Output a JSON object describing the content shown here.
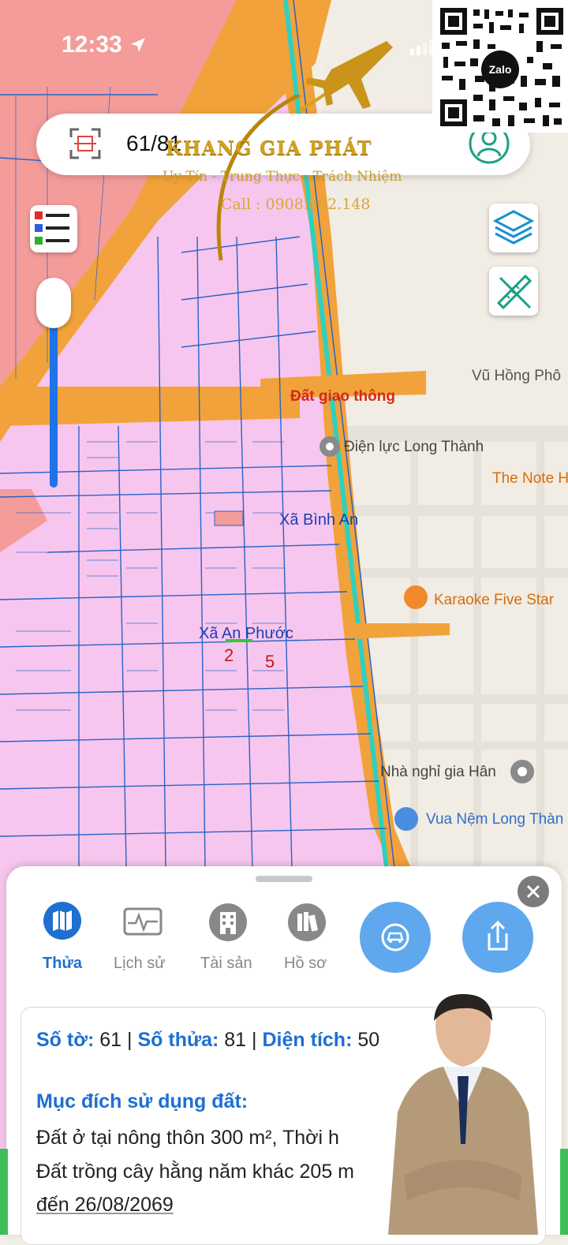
{
  "status": {
    "time": "12:33"
  },
  "search": {
    "value": "61/81"
  },
  "watermark": {
    "brand": "KHANG GIA PHÁT",
    "slogan": "Uy Tín - Trung Thực - Trách Nhiệm",
    "call": "Call : 0908.862.148",
    "qr_badge": "Zalo"
  },
  "map": {
    "labels": {
      "road_vu_hong_pho": "Vũ Hồng Phô",
      "dat_giao_thong": "Đất giao thông",
      "dien_luc": "Điện lực Long Thành",
      "the_note": "The Note H",
      "xa_binh_an": "Xã Bình An",
      "karaoke": "Karaoke Five Star",
      "xa_an_phuoc": "Xã An Phước",
      "nha_nghi": "Nhà nghỉ gia Hân",
      "vua_nem": "Vua Nệm Long Thàn",
      "parcel_2": "2",
      "parcel_5": "5"
    },
    "colors": {
      "land": "#f7c6ee",
      "residential": "#f49c9a",
      "road": "#f2a23a",
      "parcel_line": "#2a63c6",
      "river": "#2fd0c0"
    }
  },
  "sheet": {
    "tabs": [
      {
        "label": "Thửa",
        "icon": "map-icon",
        "active": true
      },
      {
        "label": "Lịch sử",
        "icon": "history-icon",
        "active": false
      },
      {
        "label": "Tài sản",
        "icon": "building-icon",
        "active": false
      },
      {
        "label": "Hồ sơ",
        "icon": "records-icon",
        "active": false
      }
    ],
    "info": {
      "so_to_label": "Số tờ:",
      "so_to_value": "61",
      "so_thua_label": "Số thửa:",
      "so_thua_value": "81",
      "dien_tich_label": "Diện tích:",
      "dien_tich_value": "50",
      "sep": "|"
    },
    "purpose_heading": "Mục đích sử dụng đất:",
    "purpose_lines": [
      "Đất ở tại nông thôn 300 m², Thời h",
      "Đất trồng cây hằng năm khác 205 m",
      "đến 26/08/2069"
    ]
  }
}
